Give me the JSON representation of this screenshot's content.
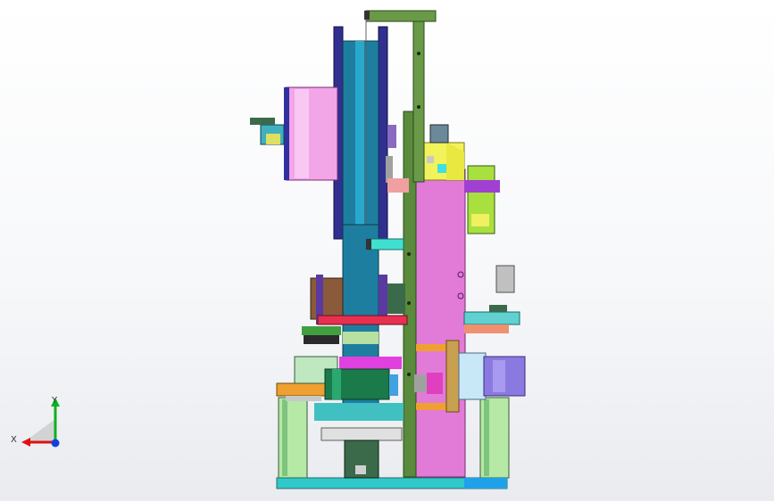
{
  "triad": {
    "x_label": "X",
    "y_label": "Y",
    "x_color": "#e01010",
    "y_color": "#10b020",
    "z_color": "#1040e0"
  },
  "palette": {
    "frame_green": "#5a8a3c",
    "body_pink": "#e27ad8",
    "drum_teal": "#1e7ea0",
    "spool_pink": "#f2a6e8",
    "base_teal": "#30c8c8",
    "motor_violet": "#8a7ae0",
    "accent_yellow": "#f0f040",
    "accent_orange": "#f0a030",
    "red_plate": "#e83050"
  }
}
